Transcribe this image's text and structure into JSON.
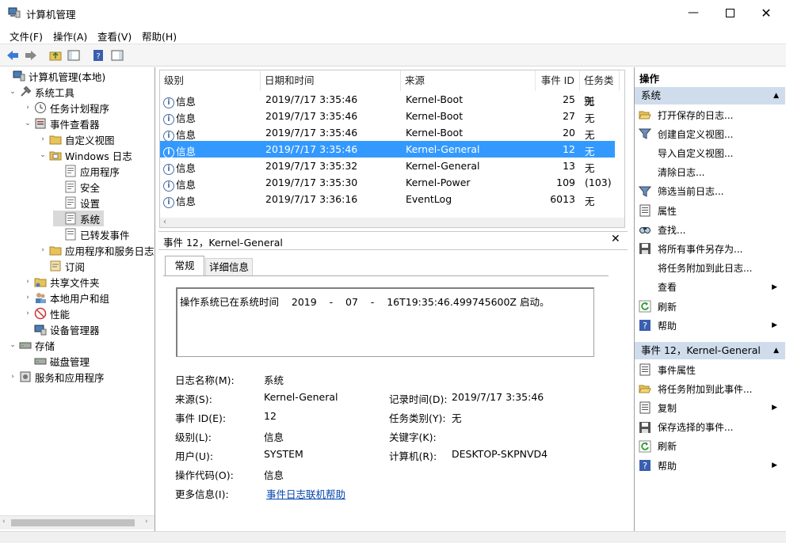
{
  "window": {
    "title": "计算机管理"
  },
  "menu": [
    "文件(F)",
    "操作(A)",
    "查看(V)",
    "帮助(H)"
  ],
  "tree": {
    "root": "计算机管理(本地)",
    "system_tools": "系统工具",
    "task_scheduler": "任务计划程序",
    "event_viewer": "事件查看器",
    "custom_views": "自定义视图",
    "windows_logs": "Windows 日志",
    "application": "应用程序",
    "security": "安全",
    "setup": "设置",
    "system": "系统",
    "forwarded": "已转发事件",
    "app_service_logs": "应用程序和服务日志",
    "subscriptions": "订阅",
    "shared_folders": "共享文件夹",
    "local_users": "本地用户和组",
    "performance": "性能",
    "device_manager": "设备管理器",
    "storage": "存储",
    "disk_mgmt": "磁盘管理",
    "services_apps": "服务和应用程序"
  },
  "events": {
    "columns": [
      "级别",
      "日期和时间",
      "来源",
      "事件 ID",
      "任务类别"
    ],
    "rows": [
      {
        "level": "信息",
        "datetime": "2019/7/17 3:35:46",
        "source": "Kernel-Boot",
        "id": "25",
        "category": "无"
      },
      {
        "level": "信息",
        "datetime": "2019/7/17 3:35:46",
        "source": "Kernel-Boot",
        "id": "27",
        "category": "无"
      },
      {
        "level": "信息",
        "datetime": "2019/7/17 3:35:46",
        "source": "Kernel-Boot",
        "id": "20",
        "category": "无"
      },
      {
        "level": "信息",
        "datetime": "2019/7/17 3:35:46",
        "source": "Kernel-General",
        "id": "12",
        "category": "无"
      },
      {
        "level": "信息",
        "datetime": "2019/7/17 3:35:32",
        "source": "Kernel-General",
        "id": "13",
        "category": "无"
      },
      {
        "level": "信息",
        "datetime": "2019/7/17 3:35:30",
        "source": "Kernel-Power",
        "id": "109",
        "category": "(103)"
      },
      {
        "level": "信息",
        "datetime": "2019/7/17 3:36:16",
        "source": "EventLog",
        "id": "6013",
        "category": "无"
      }
    ],
    "selected_index": 3
  },
  "detail": {
    "title": "事件 12，Kernel-General",
    "tab_general": "常规",
    "tab_details": "详细信息",
    "message": "操作系统已在系统时间    2019    -    07    -    16T19:35:46.499745600Z 启动。",
    "log_name_label": "日志名称(M):",
    "log_name": "系统",
    "source_label": "来源(S):",
    "source": "Kernel-General",
    "logged_label": "记录时间(D):",
    "logged": "2019/7/17 3:35:46",
    "event_id_label": "事件 ID(E):",
    "event_id": "12",
    "category_label": "任务类别(Y):",
    "category": "无",
    "level_label": "级别(L):",
    "level": "信息",
    "keywords_label": "关键字(K):",
    "user_label": "用户(U):",
    "user": "SYSTEM",
    "computer_label": "计算机(R):",
    "computer": "DESKTOP-SKPNVD4",
    "opcode_label": "操作代码(O):",
    "opcode": "信息",
    "more_info_label": "更多信息(I):",
    "more_info_link": "事件日志联机帮助"
  },
  "actions": {
    "header": "操作",
    "section1": "系统",
    "items1": [
      "打开保存的日志...",
      "创建自定义视图...",
      "导入自定义视图...",
      "清除日志...",
      "筛选当前日志...",
      "属性",
      "查找...",
      "将所有事件另存为...",
      "将任务附加到此日志...",
      "查看",
      "刷新",
      "帮助"
    ],
    "section2": "事件 12，Kernel-General",
    "items2": [
      "事件属性",
      "将任务附加到此事件...",
      "复制",
      "保存选择的事件...",
      "刷新",
      "帮助"
    ]
  },
  "colors": {
    "selection": "#3399ff",
    "section_bg": "#cfdcec",
    "link": "#0645ad"
  }
}
